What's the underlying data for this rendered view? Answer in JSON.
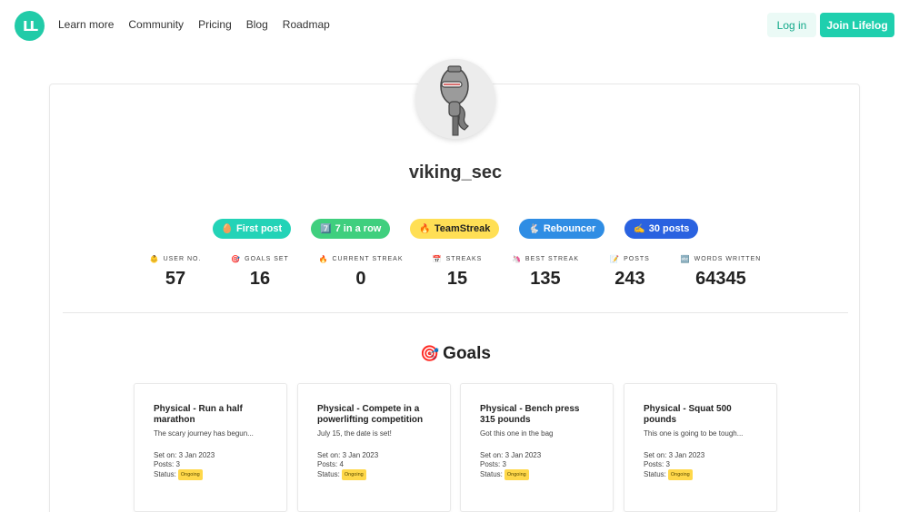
{
  "nav": {
    "logo_text": "LL",
    "links": [
      "Learn more",
      "Community",
      "Pricing",
      "Blog",
      "Roadmap"
    ],
    "login_label": "Log in",
    "join_label": "Join Lifelog"
  },
  "profile": {
    "username": "viking_sec",
    "badges": [
      {
        "icon": "🥚",
        "label": "First post",
        "bg": "#23d3b7",
        "color": "#ffffff"
      },
      {
        "icon": "7️⃣",
        "label": "7 in a row",
        "bg": "#3fcf7e",
        "color": "#ffffff"
      },
      {
        "icon": "🔥",
        "label": "TeamStreak",
        "bg": "#ffdf55",
        "color": "#222222"
      },
      {
        "icon": "🐇",
        "label": "Rebouncer",
        "bg": "#2f8de4",
        "color": "#ffffff"
      },
      {
        "icon": "✍️",
        "label": "30 posts",
        "bg": "#2a62e0",
        "color": "#ffffff"
      }
    ],
    "stats": [
      {
        "icon": "👶",
        "label": "USER NO.",
        "value": "57"
      },
      {
        "icon": "🎯",
        "label": "GOALS SET",
        "value": "16"
      },
      {
        "icon": "🔥",
        "label": "CURRENT STREAK",
        "value": "0"
      },
      {
        "icon": "📅",
        "label": "STREAKS",
        "value": "15"
      },
      {
        "icon": "🦄",
        "label": "BEST STREAK",
        "value": "135"
      },
      {
        "icon": "📝",
        "label": "POSTS",
        "value": "243"
      },
      {
        "icon": "🔤",
        "label": "WORDS WRITTEN",
        "value": "64345"
      }
    ]
  },
  "goals": {
    "icon": "🎯",
    "title": "Goals",
    "items": [
      {
        "title": "Physical - Run a half marathon",
        "description": "The scary journey has begun...",
        "set_on": "Set on: 3 Jan 2023",
        "posts": "Posts: 3",
        "status_label": "Status:",
        "status": "Ongoing"
      },
      {
        "title": "Physical - Compete in a powerlifting competition",
        "description": "July 15, the date is set!",
        "set_on": "Set on: 3 Jan 2023",
        "posts": "Posts: 4",
        "status_label": "Status:",
        "status": "Ongoing"
      },
      {
        "title": "Physical - Bench press 315 pounds",
        "description": "Got this one in the bag",
        "set_on": "Set on: 3 Jan 2023",
        "posts": "Posts: 3",
        "status_label": "Status:",
        "status": "Ongoing"
      },
      {
        "title": "Physical - Squat 500 pounds",
        "description": "This one is going to be tough...",
        "set_on": "Set on: 3 Jan 2023",
        "posts": "Posts: 3",
        "status_label": "Status:",
        "status": "Ongoing"
      }
    ]
  }
}
